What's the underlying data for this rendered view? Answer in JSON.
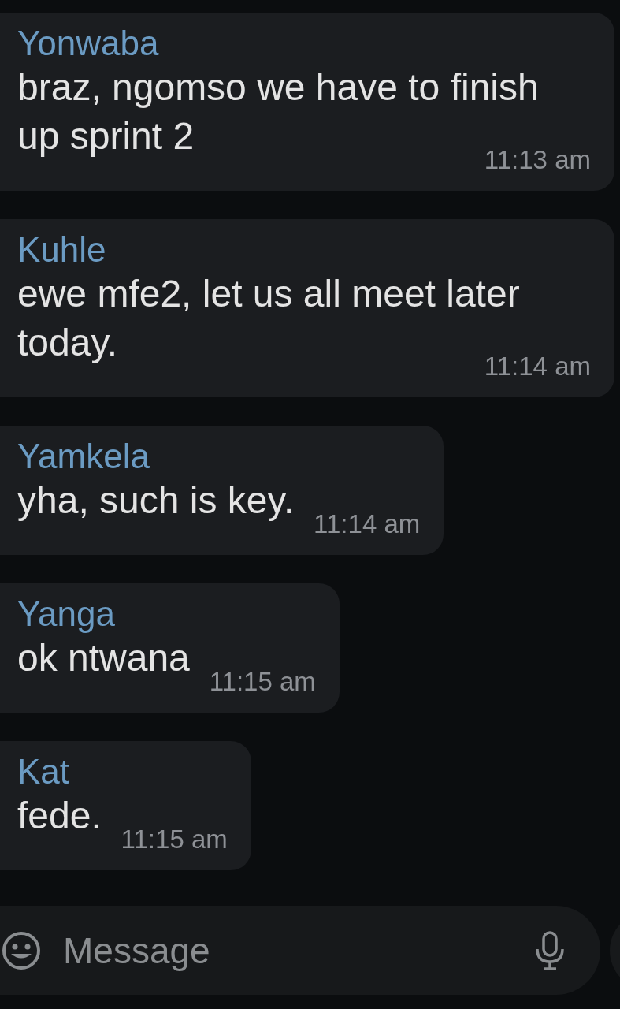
{
  "messages": [
    {
      "sender": "Yonwaba",
      "text": "braz, ngomso we have to finish up sprint 2",
      "time": "11:13 am"
    },
    {
      "sender": "Kuhle",
      "text": "ewe mfe2, let us all meet later today.",
      "time": "11:14 am"
    },
    {
      "sender": "Yamkela",
      "text": "yha, such is key.",
      "time": "11:14 am"
    },
    {
      "sender": "Yanga",
      "text": "ok ntwana",
      "time": "11:15 am"
    },
    {
      "sender": "Kat",
      "text": "fede.",
      "time": "11:15 am"
    }
  ],
  "composer": {
    "placeholder": "Message"
  }
}
